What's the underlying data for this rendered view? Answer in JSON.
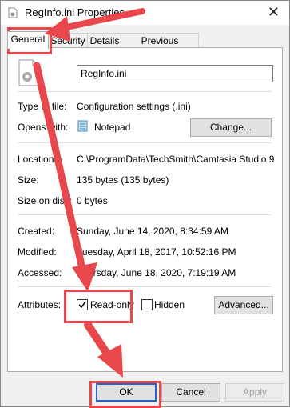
{
  "window": {
    "title": "RegInfo.ini Properties",
    "close_label": "✕"
  },
  "tabs": [
    {
      "label": "General",
      "active": true
    },
    {
      "label": "Security",
      "active": false
    },
    {
      "label": "Details",
      "active": false
    },
    {
      "label": "Previous Versions",
      "active": false
    }
  ],
  "general": {
    "filename": "RegInfo.ini",
    "type_label": "Type of file:",
    "type_value": "Configuration settings (.ini)",
    "opens_label": "Opens with:",
    "opens_value": "Notepad",
    "change_button": "Change...",
    "location_label": "Location:",
    "location_value": "C:\\ProgramData\\TechSmith\\Camtasia Studio 9",
    "size_label": "Size:",
    "size_value": "135 bytes (135 bytes)",
    "size_on_disk_label": "Size on disk:",
    "size_on_disk_value": "0 bytes",
    "created_label": "Created:",
    "created_value": "Sunday, June 14, 2020, 8:34:59 AM",
    "modified_label": "Modified:",
    "modified_value": "Tuesday, April 18, 2017, 10:52:16 PM",
    "accessed_label": "Accessed:",
    "accessed_value": "Thursday, June 18, 2020, 7:19:19 AM",
    "attributes_label": "Attributes:",
    "readonly_label": "Read-only",
    "readonly_checked": true,
    "hidden_label": "Hidden",
    "hidden_checked": false,
    "advanced_button": "Advanced..."
  },
  "footer": {
    "ok_label": "OK",
    "cancel_label": "Cancel",
    "apply_label": "Apply"
  },
  "colors": {
    "annotation": "#e8474b",
    "ok_focus": "#2b60c4"
  }
}
